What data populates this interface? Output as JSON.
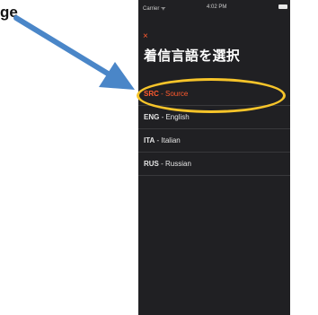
{
  "annotation": {
    "label": "ge"
  },
  "status_bar": {
    "carrier": "Carrier ᯤ",
    "time": "4:02 PM"
  },
  "header": {
    "close_glyph": "×",
    "title": "着信言語を選択"
  },
  "languages": [
    {
      "code": "SRC",
      "name": "Source",
      "active": true
    },
    {
      "code": "ENG",
      "name": "English",
      "active": false
    },
    {
      "code": "ITA",
      "name": "Italian",
      "active": false
    },
    {
      "code": "RUS",
      "name": "Russian",
      "active": false
    }
  ],
  "separator": " - ",
  "colors": {
    "accent": "#ff5a2e",
    "highlight_ring": "#f6c42a",
    "arrow": "#4a86c8",
    "background": "#202023"
  }
}
